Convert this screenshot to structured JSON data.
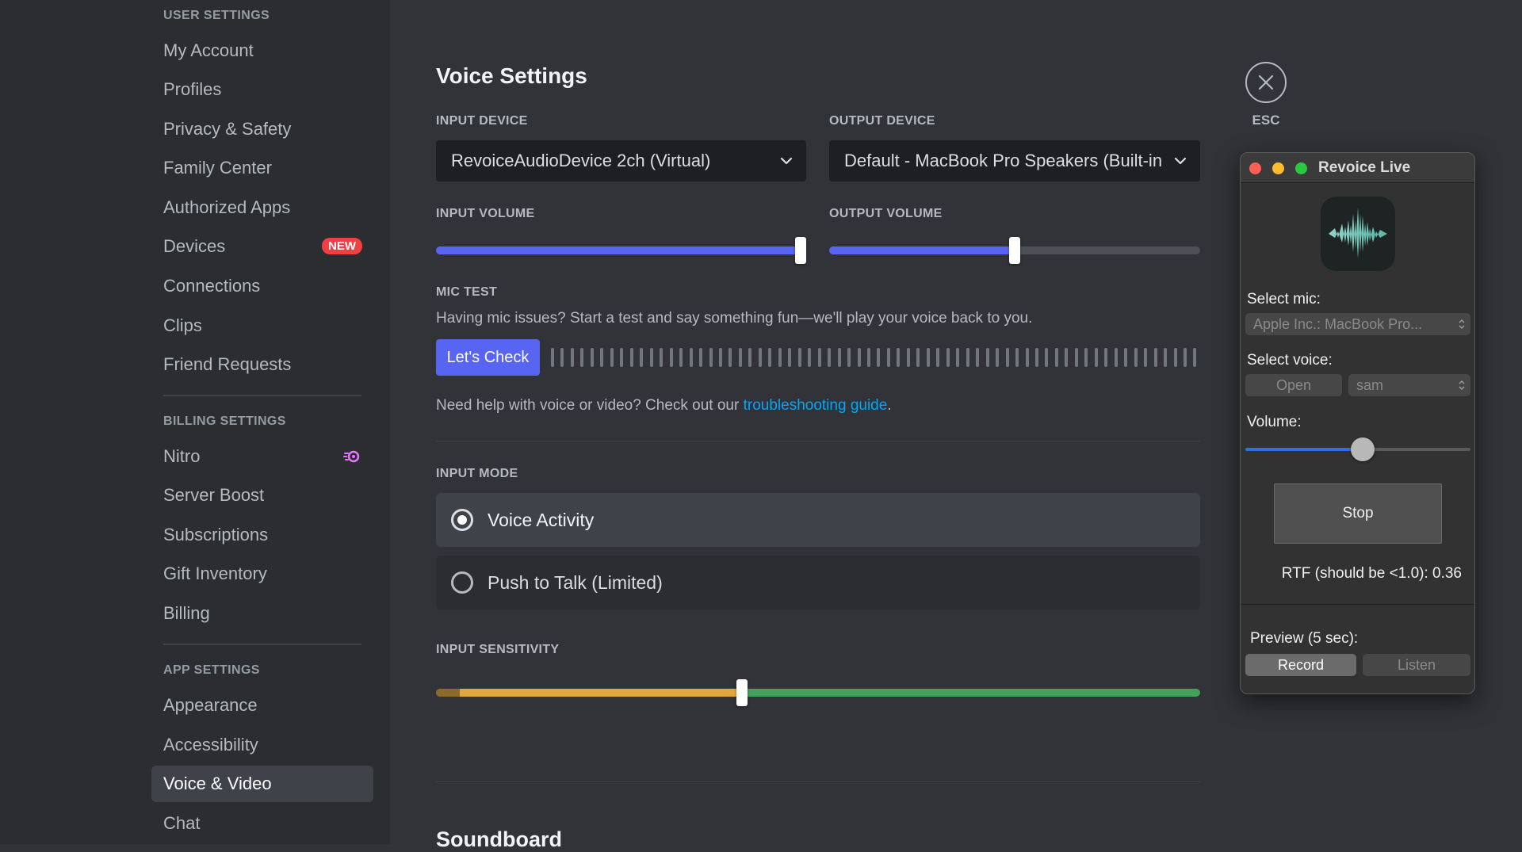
{
  "sidebar": {
    "user_header": "USER SETTINGS",
    "user_items": [
      "My Account",
      "Profiles",
      "Privacy & Safety",
      "Family Center",
      "Authorized Apps",
      "Devices",
      "Connections",
      "Clips",
      "Friend Requests"
    ],
    "devices_badge": "NEW",
    "billing_header": "BILLING SETTINGS",
    "billing_items": [
      "Nitro",
      "Server Boost",
      "Subscriptions",
      "Gift Inventory",
      "Billing"
    ],
    "app_header": "APP SETTINGS",
    "app_items": [
      "Appearance",
      "Accessibility",
      "Voice & Video",
      "Chat"
    ]
  },
  "voice": {
    "title": "Voice Settings",
    "input_device_label": "INPUT DEVICE",
    "input_device_value": "RevoiceAudioDevice 2ch (Virtual)",
    "output_device_label": "OUTPUT DEVICE",
    "output_device_value": "Default - MacBook Pro Speakers (Built-in)",
    "input_volume_label": "INPUT VOLUME",
    "input_volume": 0.985,
    "output_volume_label": "OUTPUT VOLUME",
    "output_volume": 0.5,
    "mic_test_label": "MIC TEST",
    "mic_test_desc": "Having mic issues? Start a test and say something fun—we'll play your voice back to you.",
    "lets_check": "Let's Check",
    "help_text": "Need help with voice or video? Check out our ",
    "help_link": "troubleshooting guide",
    "help_end": ".",
    "input_mode_label": "INPUT MODE",
    "mode_voice_activity": "Voice Activity",
    "mode_push_to_talk": "Push to Talk (Limited)",
    "input_sensitivity_label": "INPUT SENSITIVITY",
    "input_sensitivity": 0.4,
    "soundboard_title": "Soundboard"
  },
  "close": {
    "label": "ESC"
  },
  "revoice": {
    "title": "Revoice Live",
    "select_mic_label": "Select mic:",
    "mic_value": "Apple Inc.: MacBook Pro...",
    "select_voice_label": "Select voice:",
    "open_label": "Open",
    "voice_value": "sam",
    "volume_label": "Volume:",
    "volume": 0.52,
    "stop_label": "Stop",
    "rtf_text": "RTF (should be <1.0): 0.36",
    "preview_label": "Preview (5 sec):",
    "record_label": "Record",
    "listen_label": "Listen"
  },
  "colors": {
    "accent": "#5865f2",
    "danger": "#f23f43",
    "link": "#00a8fc",
    "sensitivity_low": "#e0a83b",
    "sensitivity_high": "#43a25a"
  }
}
